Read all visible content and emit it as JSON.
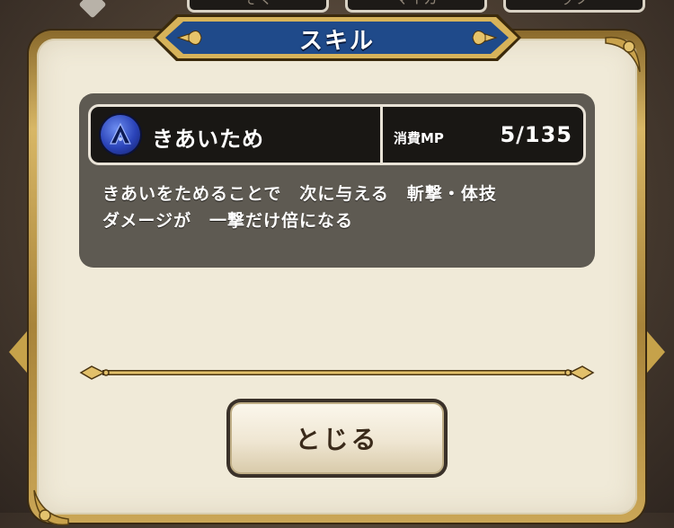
{
  "background": {
    "tabs": [
      {
        "label": "ぞく"
      },
      {
        "label": "マイカ"
      },
      {
        "label": "ッツ"
      }
    ]
  },
  "dialog": {
    "title": "スキル",
    "skill": {
      "name": "きあいため",
      "icon": "skill-orb-icon",
      "mp_label": "消費MP",
      "mp_value": "5/135",
      "description_lines": [
        "きあいをためることで　次に与える　斬撃・体技",
        "ダメージが　一撃だけ倍になる"
      ]
    },
    "close_button": {
      "label": "とじる"
    }
  },
  "colors": {
    "frame_gold": "#d8b766",
    "panel_bg": "#f0ead8",
    "title_banner": "#1f4a8a",
    "skill_panel": "#5e5a52"
  }
}
